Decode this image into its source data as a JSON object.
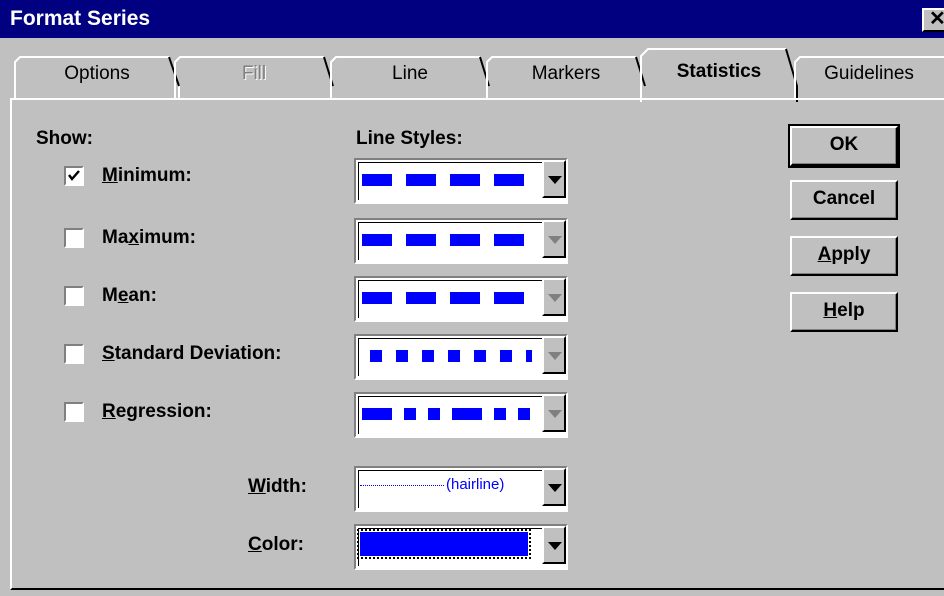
{
  "window": {
    "title": "Format Series",
    "close_glyph": "✕"
  },
  "tabs": [
    {
      "label": "Options",
      "active": false,
      "disabled": false
    },
    {
      "label": "Fill",
      "active": false,
      "disabled": true
    },
    {
      "label": "Line",
      "active": false,
      "disabled": false
    },
    {
      "label": "Markers",
      "active": false,
      "disabled": false
    },
    {
      "label": "Statistics",
      "active": true,
      "disabled": false
    },
    {
      "label": "Guidelines",
      "active": false,
      "disabled": false
    }
  ],
  "show_header": "Show:",
  "line_styles_header": "Line Styles:",
  "stats": [
    {
      "pre": "",
      "key": "M",
      "post": "inimum:",
      "checked": true,
      "style": "dash",
      "enabled": true
    },
    {
      "pre": "Ma",
      "key": "x",
      "post": "imum:",
      "checked": false,
      "style": "dash",
      "enabled": false
    },
    {
      "pre": "M",
      "key": "e",
      "post": "an:",
      "checked": false,
      "style": "dash",
      "enabled": false
    },
    {
      "pre": "",
      "key": "S",
      "post": "tandard Deviation:",
      "checked": false,
      "style": "dot",
      "enabled": false
    },
    {
      "pre": "",
      "key": "R",
      "post": "egression:",
      "checked": false,
      "style": "dashdot",
      "enabled": false
    }
  ],
  "width": {
    "pre": "",
    "key": "W",
    "post": "idth:",
    "value": "(hairline)"
  },
  "color": {
    "pre": "",
    "key": "C",
    "post": "olor:",
    "value": "#0000ff"
  },
  "buttons": [
    {
      "pre": "",
      "key": "",
      "post": "OK",
      "default": true
    },
    {
      "pre": "",
      "key": "",
      "post": "Cancel",
      "default": false
    },
    {
      "pre": "",
      "key": "A",
      "post": "pply",
      "default": false
    },
    {
      "pre": "",
      "key": "H",
      "post": "elp",
      "default": false
    }
  ],
  "colors": {
    "face": "#c0c0c0",
    "title_bar": "#000080",
    "line_blue": "#0000ff"
  }
}
